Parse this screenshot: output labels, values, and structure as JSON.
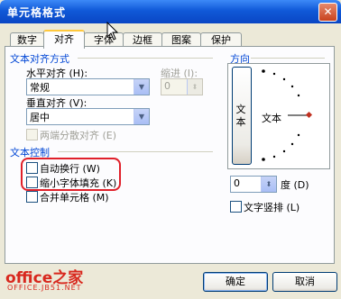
{
  "window": {
    "title": "单元格格式",
    "close_symbol": "✕"
  },
  "tabs": [
    {
      "label": "数字",
      "active": false
    },
    {
      "label": "对齐",
      "active": true
    },
    {
      "label": "字体",
      "active": false
    },
    {
      "label": "边框",
      "active": false
    },
    {
      "label": "图案",
      "active": false
    },
    {
      "label": "保护",
      "active": false
    }
  ],
  "text_alignment": {
    "section_label": "文本对齐方式",
    "horizontal_label": "水平对齐 (H):",
    "horizontal_value": "常规",
    "indent_label": "缩进 (I):",
    "indent_value": "0",
    "vertical_label": "垂直对齐 (V):",
    "vertical_value": "居中",
    "justify_distributed_label": "两端分散对齐 (E)"
  },
  "text_control": {
    "section_label": "文本控制",
    "wrap_text_label": "自动换行 (W)",
    "shrink_to_fit_label": "缩小字体填充 (K)",
    "merge_cells_label": "合并单元格 (M)"
  },
  "orientation": {
    "section_label": "方向",
    "vertical_text": "文本",
    "dial_text": "文本",
    "degrees_value": "0",
    "degrees_label": "度 (D)",
    "vertical_text_label": "文字竖排 (L)"
  },
  "buttons": {
    "ok": "确定",
    "cancel": "取消"
  },
  "watermark": {
    "brand": "office之家",
    "url": "OFFICE.JB51.NET"
  },
  "colors": {
    "title_bar": "#0a46c4",
    "section_label": "#0046d5",
    "highlight": "#e0202a",
    "dial_marker": "#c03020"
  }
}
